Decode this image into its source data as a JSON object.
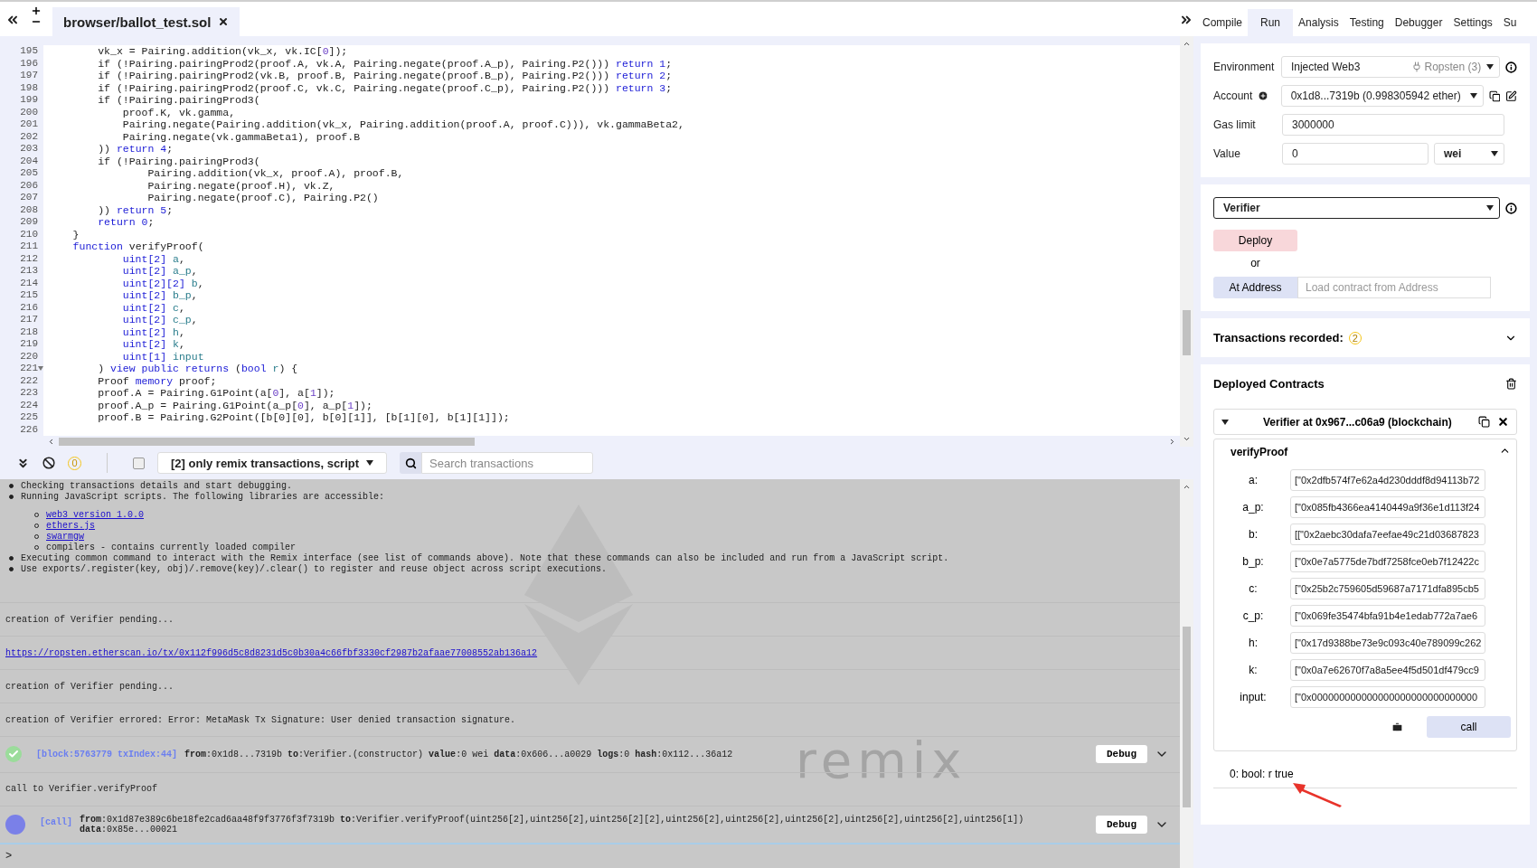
{
  "editor": {
    "file_tab": {
      "label": "browser/ballot_test.sol",
      "selected": true
    },
    "lines": [
      {
        "num": "195",
        "fold": false,
        "code": [
          {
            "kind": "plain",
            "t": "        vk_x = Pairing.addition(vk_x, vk.IC["
          },
          {
            "kind": "num",
            "t": "0"
          },
          {
            "kind": "plain",
            "t": "]);"
          }
        ]
      },
      {
        "num": "196",
        "fold": false,
        "code": [
          {
            "kind": "plain",
            "t": "        if (!Pairing.pairingProd2(proof.A, vk.A, Pairing.negate(proof.A_p), Pairing.P2())) "
          },
          {
            "kind": "kw",
            "t": "return 1"
          },
          {
            "kind": "plain",
            "t": ";"
          }
        ]
      },
      {
        "num": "197",
        "fold": false,
        "code": [
          {
            "kind": "plain",
            "t": "        if (!Pairing.pairingProd2(vk.B, proof.B, Pairing.negate(proof.B_p), Pairing.P2())) "
          },
          {
            "kind": "kw",
            "t": "return 2"
          },
          {
            "kind": "plain",
            "t": ";"
          }
        ]
      },
      {
        "num": "198",
        "fold": false,
        "code": [
          {
            "kind": "plain",
            "t": "        if (!Pairing.pairingProd2(proof.C, vk.C, Pairing.negate(proof.C_p), Pairing.P2())) "
          },
          {
            "kind": "kw",
            "t": "return 3"
          },
          {
            "kind": "plain",
            "t": ";"
          }
        ]
      },
      {
        "num": "199",
        "fold": false,
        "code": [
          {
            "kind": "plain",
            "t": "        if (!Pairing.pairingProd3("
          }
        ]
      },
      {
        "num": "200",
        "fold": false,
        "code": [
          {
            "kind": "plain",
            "t": "            proof.K, vk.gamma,"
          }
        ]
      },
      {
        "num": "201",
        "fold": false,
        "code": [
          {
            "kind": "plain",
            "t": "            Pairing.negate(Pairing.addition(vk_x, Pairing.addition(proof.A, proof.C))), vk.gammaBeta2,"
          }
        ]
      },
      {
        "num": "202",
        "fold": false,
        "code": [
          {
            "kind": "plain",
            "t": "            Pairing.negate(vk.gammaBeta1), proof.B"
          }
        ]
      },
      {
        "num": "203",
        "fold": false,
        "code": [
          {
            "kind": "plain",
            "t": "        )) "
          },
          {
            "kind": "kw",
            "t": "return 4"
          },
          {
            "kind": "plain",
            "t": ";"
          }
        ]
      },
      {
        "num": "204",
        "fold": false,
        "code": [
          {
            "kind": "plain",
            "t": "        if (!Pairing.pairingProd3("
          }
        ]
      },
      {
        "num": "205",
        "fold": false,
        "code": [
          {
            "kind": "plain",
            "t": "                Pairing.addition(vk_x, proof.A), proof.B,"
          }
        ]
      },
      {
        "num": "206",
        "fold": false,
        "code": [
          {
            "kind": "plain",
            "t": "                Pairing.negate(proof.H), vk.Z,"
          }
        ]
      },
      {
        "num": "207",
        "fold": false,
        "code": [
          {
            "kind": "plain",
            "t": "                Pairing.negate(proof.C), Pairing.P2()"
          }
        ]
      },
      {
        "num": "208",
        "fold": false,
        "code": [
          {
            "kind": "plain",
            "t": "        )) "
          },
          {
            "kind": "kw",
            "t": "return 5"
          },
          {
            "kind": "plain",
            "t": ";"
          }
        ]
      },
      {
        "num": "209",
        "fold": false,
        "code": [
          {
            "kind": "kw",
            "t": "        return 0"
          },
          {
            "kind": "plain",
            "t": ";"
          }
        ]
      },
      {
        "num": "210",
        "fold": false,
        "code": [
          {
            "kind": "plain",
            "t": "    }"
          }
        ]
      },
      {
        "num": "211",
        "fold": false,
        "code": [
          {
            "kind": "kw",
            "t": "    function"
          },
          {
            "kind": "plain",
            "t": " verifyProof("
          }
        ]
      },
      {
        "num": "212",
        "fold": false,
        "code": [
          {
            "kind": "kw",
            "t": "            uint[2]"
          },
          {
            "kind": "var",
            "t": " a"
          },
          {
            "kind": "plain",
            "t": ","
          }
        ]
      },
      {
        "num": "213",
        "fold": false,
        "code": [
          {
            "kind": "kw",
            "t": "            uint[2]"
          },
          {
            "kind": "var",
            "t": " a_p"
          },
          {
            "kind": "plain",
            "t": ","
          }
        ]
      },
      {
        "num": "214",
        "fold": false,
        "code": [
          {
            "kind": "kw",
            "t": "            uint[2][2]"
          },
          {
            "kind": "var",
            "t": " b"
          },
          {
            "kind": "plain",
            "t": ","
          }
        ]
      },
      {
        "num": "215",
        "fold": false,
        "code": [
          {
            "kind": "kw",
            "t": "            uint[2]"
          },
          {
            "kind": "var",
            "t": " b_p"
          },
          {
            "kind": "plain",
            "t": ","
          }
        ]
      },
      {
        "num": "216",
        "fold": false,
        "code": [
          {
            "kind": "kw",
            "t": "            uint[2]"
          },
          {
            "kind": "var",
            "t": " c"
          },
          {
            "kind": "plain",
            "t": ","
          }
        ]
      },
      {
        "num": "217",
        "fold": false,
        "code": [
          {
            "kind": "kw",
            "t": "            uint[2]"
          },
          {
            "kind": "var",
            "t": " c_p"
          },
          {
            "kind": "plain",
            "t": ","
          }
        ]
      },
      {
        "num": "218",
        "fold": false,
        "code": [
          {
            "kind": "kw",
            "t": "            uint[2]"
          },
          {
            "kind": "var",
            "t": " h"
          },
          {
            "kind": "plain",
            "t": ","
          }
        ]
      },
      {
        "num": "219",
        "fold": false,
        "code": [
          {
            "kind": "kw",
            "t": "            uint[2]"
          },
          {
            "kind": "var",
            "t": " k"
          },
          {
            "kind": "plain",
            "t": ","
          }
        ]
      },
      {
        "num": "220",
        "fold": false,
        "code": [
          {
            "kind": "kw",
            "t": "            uint[1]"
          },
          {
            "kind": "var",
            "t": " input"
          }
        ]
      },
      {
        "num": "221",
        "fold": true,
        "code": [
          {
            "kind": "plain",
            "t": "        ) "
          },
          {
            "kind": "kw",
            "t": "view public returns"
          },
          {
            "kind": "plain",
            "t": " ("
          },
          {
            "kind": "kw",
            "t": "bool"
          },
          {
            "kind": "var",
            "t": " r"
          },
          {
            "kind": "plain",
            "t": ") {"
          }
        ]
      },
      {
        "num": "222",
        "fold": false,
        "code": [
          {
            "kind": "plain",
            "t": "        Proof "
          },
          {
            "kind": "kw",
            "t": "memory"
          },
          {
            "kind": "plain",
            "t": " proof;"
          }
        ]
      },
      {
        "num": "223",
        "fold": false,
        "code": [
          {
            "kind": "plain",
            "t": "        proof.A = Pairing.G1Point(a["
          },
          {
            "kind": "num",
            "t": "0"
          },
          {
            "kind": "plain",
            "t": "], a["
          },
          {
            "kind": "num",
            "t": "1"
          },
          {
            "kind": "plain",
            "t": "]);"
          }
        ]
      },
      {
        "num": "224",
        "fold": false,
        "code": [
          {
            "kind": "plain",
            "t": "        proof.A_p = Pairing.G1Point(a_p["
          },
          {
            "kind": "num",
            "t": "0"
          },
          {
            "kind": "plain",
            "t": "], a_p["
          },
          {
            "kind": "num",
            "t": "1"
          },
          {
            "kind": "plain",
            "t": "]);"
          }
        ]
      },
      {
        "num": "225",
        "fold": false,
        "code": [
          {
            "kind": "plain",
            "t": "        proof.B = Pairing.G2Point([b[0][0], b[0][1]], [b[1][0], b[1][1]]);"
          }
        ]
      },
      {
        "num": "226",
        "fold": false
      }
    ]
  },
  "terminal_bar": {
    "pending_count": "0",
    "filter_checked": false,
    "filter": "[2] only remix transactions, script",
    "search": {
      "placeholder": "Search transactions"
    }
  },
  "terminal": {
    "intro": [
      {
        "text": "Checking transactions details and start debugging."
      },
      {
        "text": "Running JavaScript scripts. The following libraries are accessible:",
        "libraries": [
          {
            "text": "web3 version 1.0.0",
            "link": true
          },
          {
            "text": "ethers.js",
            "link": true
          },
          {
            "text": "swarmgw",
            "link": true
          },
          {
            "text": "compilers - contains currently loaded compiler",
            "link": false
          }
        ]
      },
      {
        "text": "Executing common command to interact with the Remix interface (see list of commands above). Note that these commands can also be included and run from a JavaScript script."
      },
      {
        "text": "Use exports/.register(key, obj)/.remove(key)/.clear() to register and reuse object across script executions."
      }
    ],
    "watermark": "remix",
    "entries": [
      {
        "kind": "message",
        "text": "creation of Verifier pending..."
      },
      {
        "kind": "link",
        "text": "https://ropsten.etherscan.io/tx/0x112f996d5c8d8231d5c0b30a4c66fbf3330cf2987b2afaae77008552ab136a12"
      },
      {
        "kind": "message",
        "text": "creation of Verifier pending..."
      },
      {
        "kind": "message",
        "text": "creation of Verifier errored: Error: MetaMask Tx Signature: User denied transaction signature."
      },
      {
        "kind": "tx",
        "ref": "[block:5763779 txIndex:44]",
        "details": "**from**:0x1d8...7319b **to**:Verifier.(constructor) **value**:0 wei **data**:0x606...a0029 **logs**:0 **hash**:0x112...36a12",
        "button": "Debug"
      },
      {
        "kind": "message",
        "text": "call to Verifier.verifyProof"
      },
      {
        "kind": "call",
        "ref": "[call]",
        "details": "**from**:0x1d87e389c6be18fe2cad6aa48f9f3776f3f7319b **to**:Verifier.verifyProof(uint256[2],uint256[2],uint256[2][2],uint256[2],uint256[2],uint256[2],uint256[2],uint256[2],uint256[1])",
        "data": "**data**:0x85e...00021",
        "button": "Debug"
      }
    ],
    "prompt": ">"
  },
  "tabs": [
    {
      "label": "Compile",
      "selected": false
    },
    {
      "label": "Run",
      "selected": true
    },
    {
      "label": "Analysis",
      "selected": false
    },
    {
      "label": "Testing",
      "selected": false
    },
    {
      "label": "Debugger",
      "selected": false
    },
    {
      "label": "Settings",
      "selected": false
    },
    {
      "label": "Su",
      "selected": false
    }
  ],
  "settings": {
    "environment": {
      "label": "Environment",
      "value": "Injected Web3",
      "network": "Ropsten (3)"
    },
    "account": {
      "label": "Account",
      "value": "0x1d8...7319b (0.998305942 ether)"
    },
    "gas_limit": {
      "label": "Gas limit",
      "value": "3000000"
    },
    "value": {
      "label": "Value",
      "value": "0",
      "unit": "wei"
    }
  },
  "deploy": {
    "contract": "Verifier",
    "deploy_button": "Deploy",
    "or": "or",
    "at_address_button": "At Address",
    "address_placeholder": "Load contract from Address"
  },
  "transactions_recorded": {
    "label": "Transactions recorded:",
    "count": "2"
  },
  "deployed": {
    "title": "Deployed Contracts",
    "instance": "Verifier at 0x967...c06a9 (blockchain)",
    "function": {
      "name": "verifyProof",
      "expanded": true,
      "params": [
        {
          "label": "a:",
          "value": "[\"0x2dfb574f7e62a4d230dddf8d94113b72"
        },
        {
          "label": "a_p:",
          "value": "[\"0x085fb4366ea4140449a9f36e1d113f24"
        },
        {
          "label": "b:",
          "value": "[[\"0x2aebc30dafa7eefae49c21d03687823"
        },
        {
          "label": "b_p:",
          "value": "[\"0x0e7a5775de7bdf7258fce0eb7f12422c"
        },
        {
          "label": "c:",
          "value": "[\"0x25b2c759605d59687a7171dfa895cb5"
        },
        {
          "label": "c_p:",
          "value": "[\"0x069fe35474bfa91b4e1edab772a7ae6"
        },
        {
          "label": "h:",
          "value": "[\"0x17d9388be73e9c093c40e789099c262"
        },
        {
          "label": "k:",
          "value": "[\"0x0a7e62670f7a8a5ee4f5d501df479cc9"
        },
        {
          "label": "input:",
          "value": "[\"0x000000000000000000000000000000"
        }
      ],
      "call_button": "call"
    },
    "result": "0: bool: r true"
  }
}
